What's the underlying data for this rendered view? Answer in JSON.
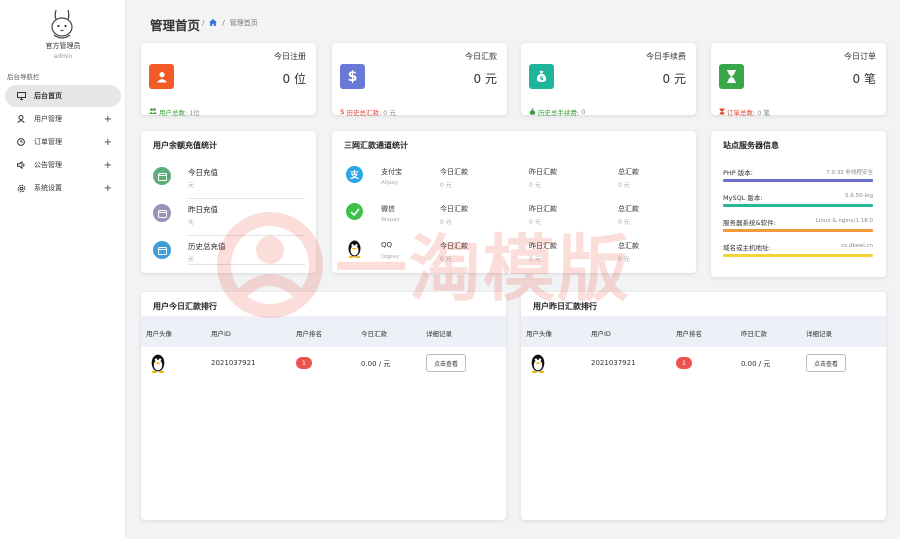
{
  "sidebar": {
    "admin_name": "官方管理员",
    "admin_role": "admin",
    "nav_title": "后台导航栏",
    "items": [
      {
        "label": "后台首页",
        "icon": "monitor-icon"
      },
      {
        "label": "用户管理",
        "icon": "user-icon"
      },
      {
        "label": "订单管理",
        "icon": "clock-icon"
      },
      {
        "label": "公告管理",
        "icon": "speaker-icon"
      },
      {
        "label": "系统设置",
        "icon": "gear-icon"
      }
    ],
    "expand_symbol": "+"
  },
  "header": {
    "title": "管理首页",
    "sep": "/",
    "breadcrumb_current": "管理首页"
  },
  "stats": [
    {
      "title": "今日注册",
      "value": "0 位",
      "foot_label": "用户总数:",
      "foot_value": "1位",
      "color": "#f35a26",
      "foot_color": "#3a9d3a",
      "icon": "user-icon"
    },
    {
      "title": "今日汇款",
      "value": "0 元",
      "foot_label": "历史总汇款:",
      "foot_value": "0 元",
      "color": "#6a78d8",
      "foot_color": "#e0432f",
      "icon": "dollar-icon"
    },
    {
      "title": "今日手续费",
      "value": "0 元",
      "foot_label": "历史总手续费:",
      "foot_value": "0",
      "color": "#1fb59a",
      "foot_color": "#3a9d3a",
      "icon": "money-bag-icon"
    },
    {
      "title": "今日订单",
      "value": "0 笔",
      "foot_label": "订单总数:",
      "foot_value": "0 笔",
      "color": "#3aa64a",
      "foot_color": "#e0432f",
      "icon": "hourglass-icon"
    }
  ],
  "balance": {
    "title": "用户余额充值统计",
    "rows": [
      {
        "name": "今日充值",
        "unit": "元",
        "color": "#5fae7a",
        "icon": "calendar-icon"
      },
      {
        "name": "昨日充值",
        "unit": "元",
        "color": "#9a93b8",
        "icon": "calendar-icon"
      },
      {
        "name": "历史总充值",
        "unit": "元",
        "color": "#3e9fd8",
        "icon": "calendar-icon"
      }
    ]
  },
  "channels": {
    "title": "三网汇款通道统计",
    "rows": [
      {
        "name": "支付宝",
        "sub": "Alipay",
        "color": "#2aa4e8",
        "icon": "alipay-icon"
      },
      {
        "name": "微信",
        "sub": "Wxpay",
        "color": "#3cc24a",
        "icon": "wechat-icon"
      },
      {
        "name": "QQ",
        "sub": "Qqpay",
        "color": "#222222",
        "icon": "qq-icon"
      }
    ],
    "col_heads": [
      "今日汇款",
      "昨日汇款",
      "总汇款"
    ],
    "value": "0 元"
  },
  "server": {
    "title": "站点服务器信息",
    "rows": [
      {
        "k": "PHP 版本:",
        "v": "7.0.33 非线程安全",
        "color": "#6a6fcf"
      },
      {
        "k": "MySQL 版本:",
        "v": "5.6.50-log",
        "color": "#28b899"
      },
      {
        "k": "服务器系统&软件:",
        "v": "Linux & nginx/1.18.0",
        "color": "#f39a3c"
      },
      {
        "k": "域名或主机地址:",
        "v": "cs.dkewl.cn",
        "color": "#f2d43a"
      }
    ]
  },
  "rank_today": {
    "title": "用户今日汇款排行",
    "heads": [
      "用户头像",
      "用户ID",
      "用户排名",
      "今日汇款",
      "详细记录"
    ],
    "row": {
      "id": "2021037921",
      "rank": "1",
      "amount": "0.00 / 元",
      "button": "点击查看"
    }
  },
  "rank_yesterday": {
    "title": "用户昨日汇款排行",
    "heads": [
      "用户头像",
      "用户ID",
      "用户排名",
      "昨日汇款",
      "详细记录"
    ],
    "row": {
      "id": "2021037921",
      "rank": "1",
      "amount": "0.00 / 元",
      "button": "点击查看"
    }
  },
  "watermark": {
    "text": "一淘模版"
  }
}
